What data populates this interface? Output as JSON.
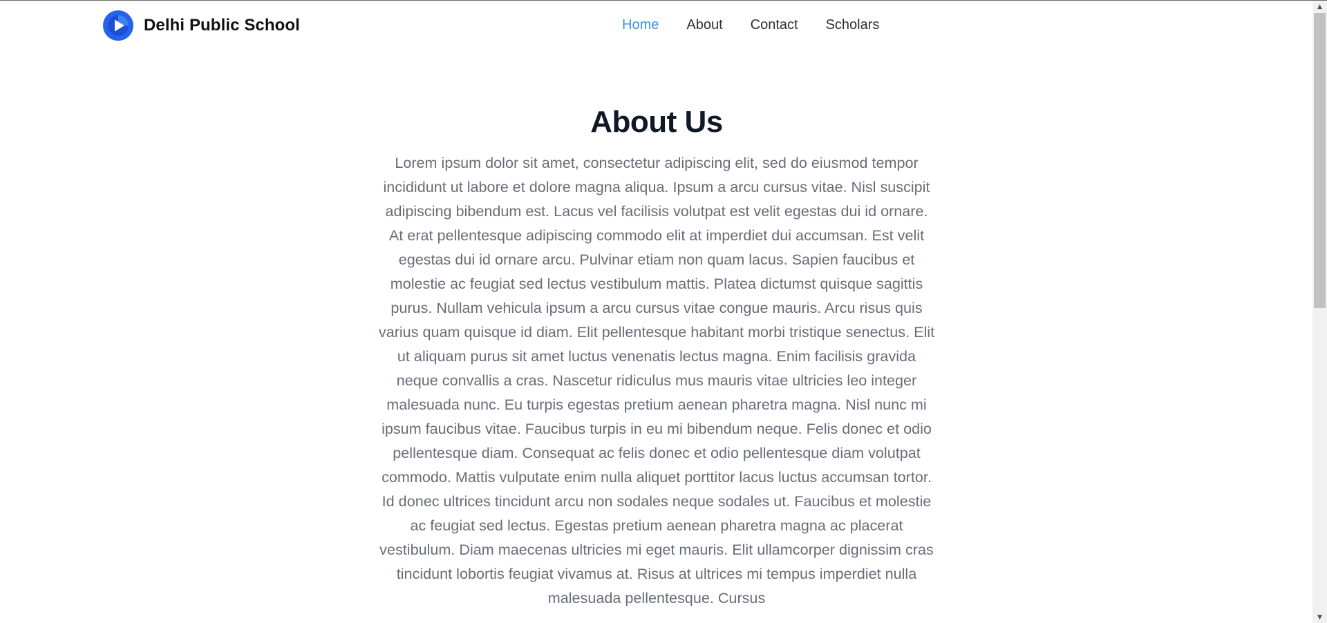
{
  "header": {
    "brand_name": "Delhi Public School",
    "logo_icon": "play-circle-icon",
    "nav": [
      {
        "label": "Home",
        "active": true
      },
      {
        "label": "About",
        "active": false
      },
      {
        "label": "Contact",
        "active": false
      },
      {
        "label": "Scholars",
        "active": false
      }
    ]
  },
  "main": {
    "title": "About Us",
    "paragraph": "Lorem ipsum dolor sit amet, consectetur adipiscing elit, sed do eiusmod tempor incididunt ut labore et dolore magna aliqua. Ipsum a arcu cursus vitae. Nisl suscipit adipiscing bibendum est. Lacus vel facilisis volutpat est velit egestas dui id ornare. At erat pellentesque adipiscing commodo elit at imperdiet dui accumsan. Est velit egestas dui id ornare arcu. Pulvinar etiam non quam lacus. Sapien faucibus et molestie ac feugiat sed lectus vestibulum mattis. Platea dictumst quisque sagittis purus. Nullam vehicula ipsum a arcu cursus vitae congue mauris. Arcu risus quis varius quam quisque id diam. Elit pellentesque habitant morbi tristique senectus. Elit ut aliquam purus sit amet luctus venenatis lectus magna. Enim facilisis gravida neque convallis a cras. Nascetur ridiculus mus mauris vitae ultricies leo integer malesuada nunc. Eu turpis egestas pretium aenean pharetra magna. Nisl nunc mi ipsum faucibus vitae. Faucibus turpis in eu mi bibendum neque. Felis donec et odio pellentesque diam. Consequat ac felis donec et odio pellentesque diam volutpat commodo. Mattis vulputate enim nulla aliquet porttitor lacus luctus accumsan tortor. Id donec ultrices tincidunt arcu non sodales neque sodales ut. Faucibus et molestie ac feugiat sed lectus. Egestas pretium aenean pharetra magna ac placerat vestibulum. Diam maecenas ultricies mi eget mauris. Elit ullamcorper dignissim cras tincidunt lobortis feugiat vivamus at. Risus at ultrices mi tempus imperdiet nulla malesuada pellentesque. Cursus"
  },
  "colors": {
    "nav_active": "#3b8fe0",
    "logo_blue": "#2563eb",
    "title": "#111827",
    "body_text": "#676d77"
  }
}
